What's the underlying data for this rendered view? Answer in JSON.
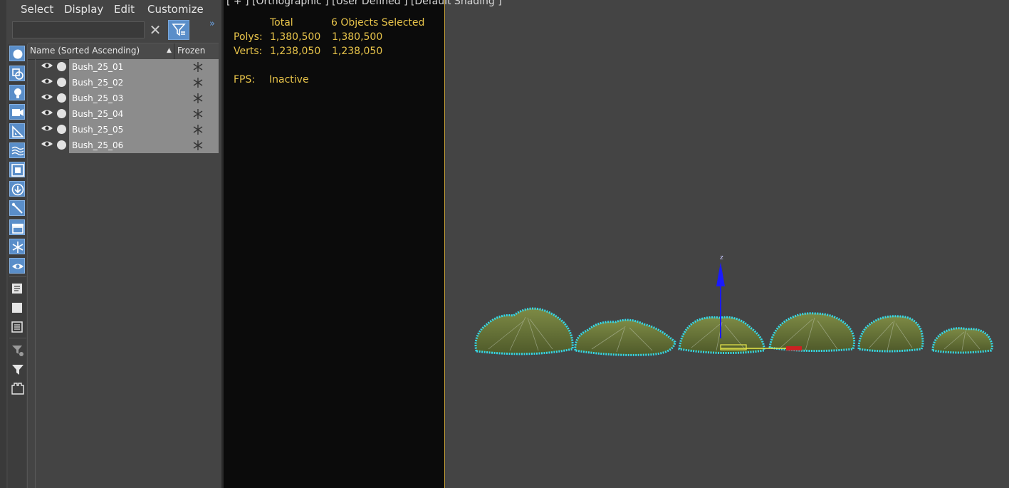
{
  "menu": {
    "select": "Select",
    "display": "Display",
    "edit": "Edit",
    "customize": "Customize"
  },
  "search": {
    "placeholder": "",
    "clear_icon": "close-icon",
    "filter_icon": "filter-icon",
    "expand_icon": "double-chevron-right-icon"
  },
  "toolbar_icons": [
    "geometry-icon",
    "shapes-icon",
    "lights-icon",
    "cameras-icon",
    "helpers-icon",
    "space-warps-icon",
    "groups-icon",
    "xrefs-icon",
    "bones-icon",
    "containers-icon",
    "frozen-filter-icon",
    "hidden-filter-icon",
    "layer-list-icon",
    "blank-icon",
    "selection-set-icon",
    "filter-settings-icon",
    "filter-icon",
    "save-icon"
  ],
  "columns": {
    "name": "Name (Sorted Ascending)",
    "sort_indicator": "▲",
    "frozen": "Frozen"
  },
  "objects": [
    {
      "name": "Bush_25_01"
    },
    {
      "name": "Bush_25_02"
    },
    {
      "name": "Bush_25_03"
    },
    {
      "name": "Bush_25_04"
    },
    {
      "name": "Bush_25_05"
    },
    {
      "name": "Bush_25_06"
    }
  ],
  "viewport": {
    "label": "[ + ] [Orthographic ] [User Defined ] [Default Shading ]",
    "stats": {
      "total_header": "Total",
      "selected_header": "6 Objects Selected",
      "polys_label": "Polys:",
      "polys_total": "1,380,500",
      "polys_selected": "1,380,500",
      "verts_label": "Verts:",
      "verts_total": "1,238,050",
      "verts_selected": "1,238,050",
      "fps_label": "FPS:",
      "fps_value": "Inactive"
    },
    "gizmo": {
      "z_label": "z"
    }
  },
  "colors": {
    "selection_blue": "#5a8ec9",
    "stats_yellow": "#e8c44a",
    "selection_outline": "#35d8e8",
    "bush_green": "#6b7a3a",
    "viewport_border": "#c9a43a"
  }
}
